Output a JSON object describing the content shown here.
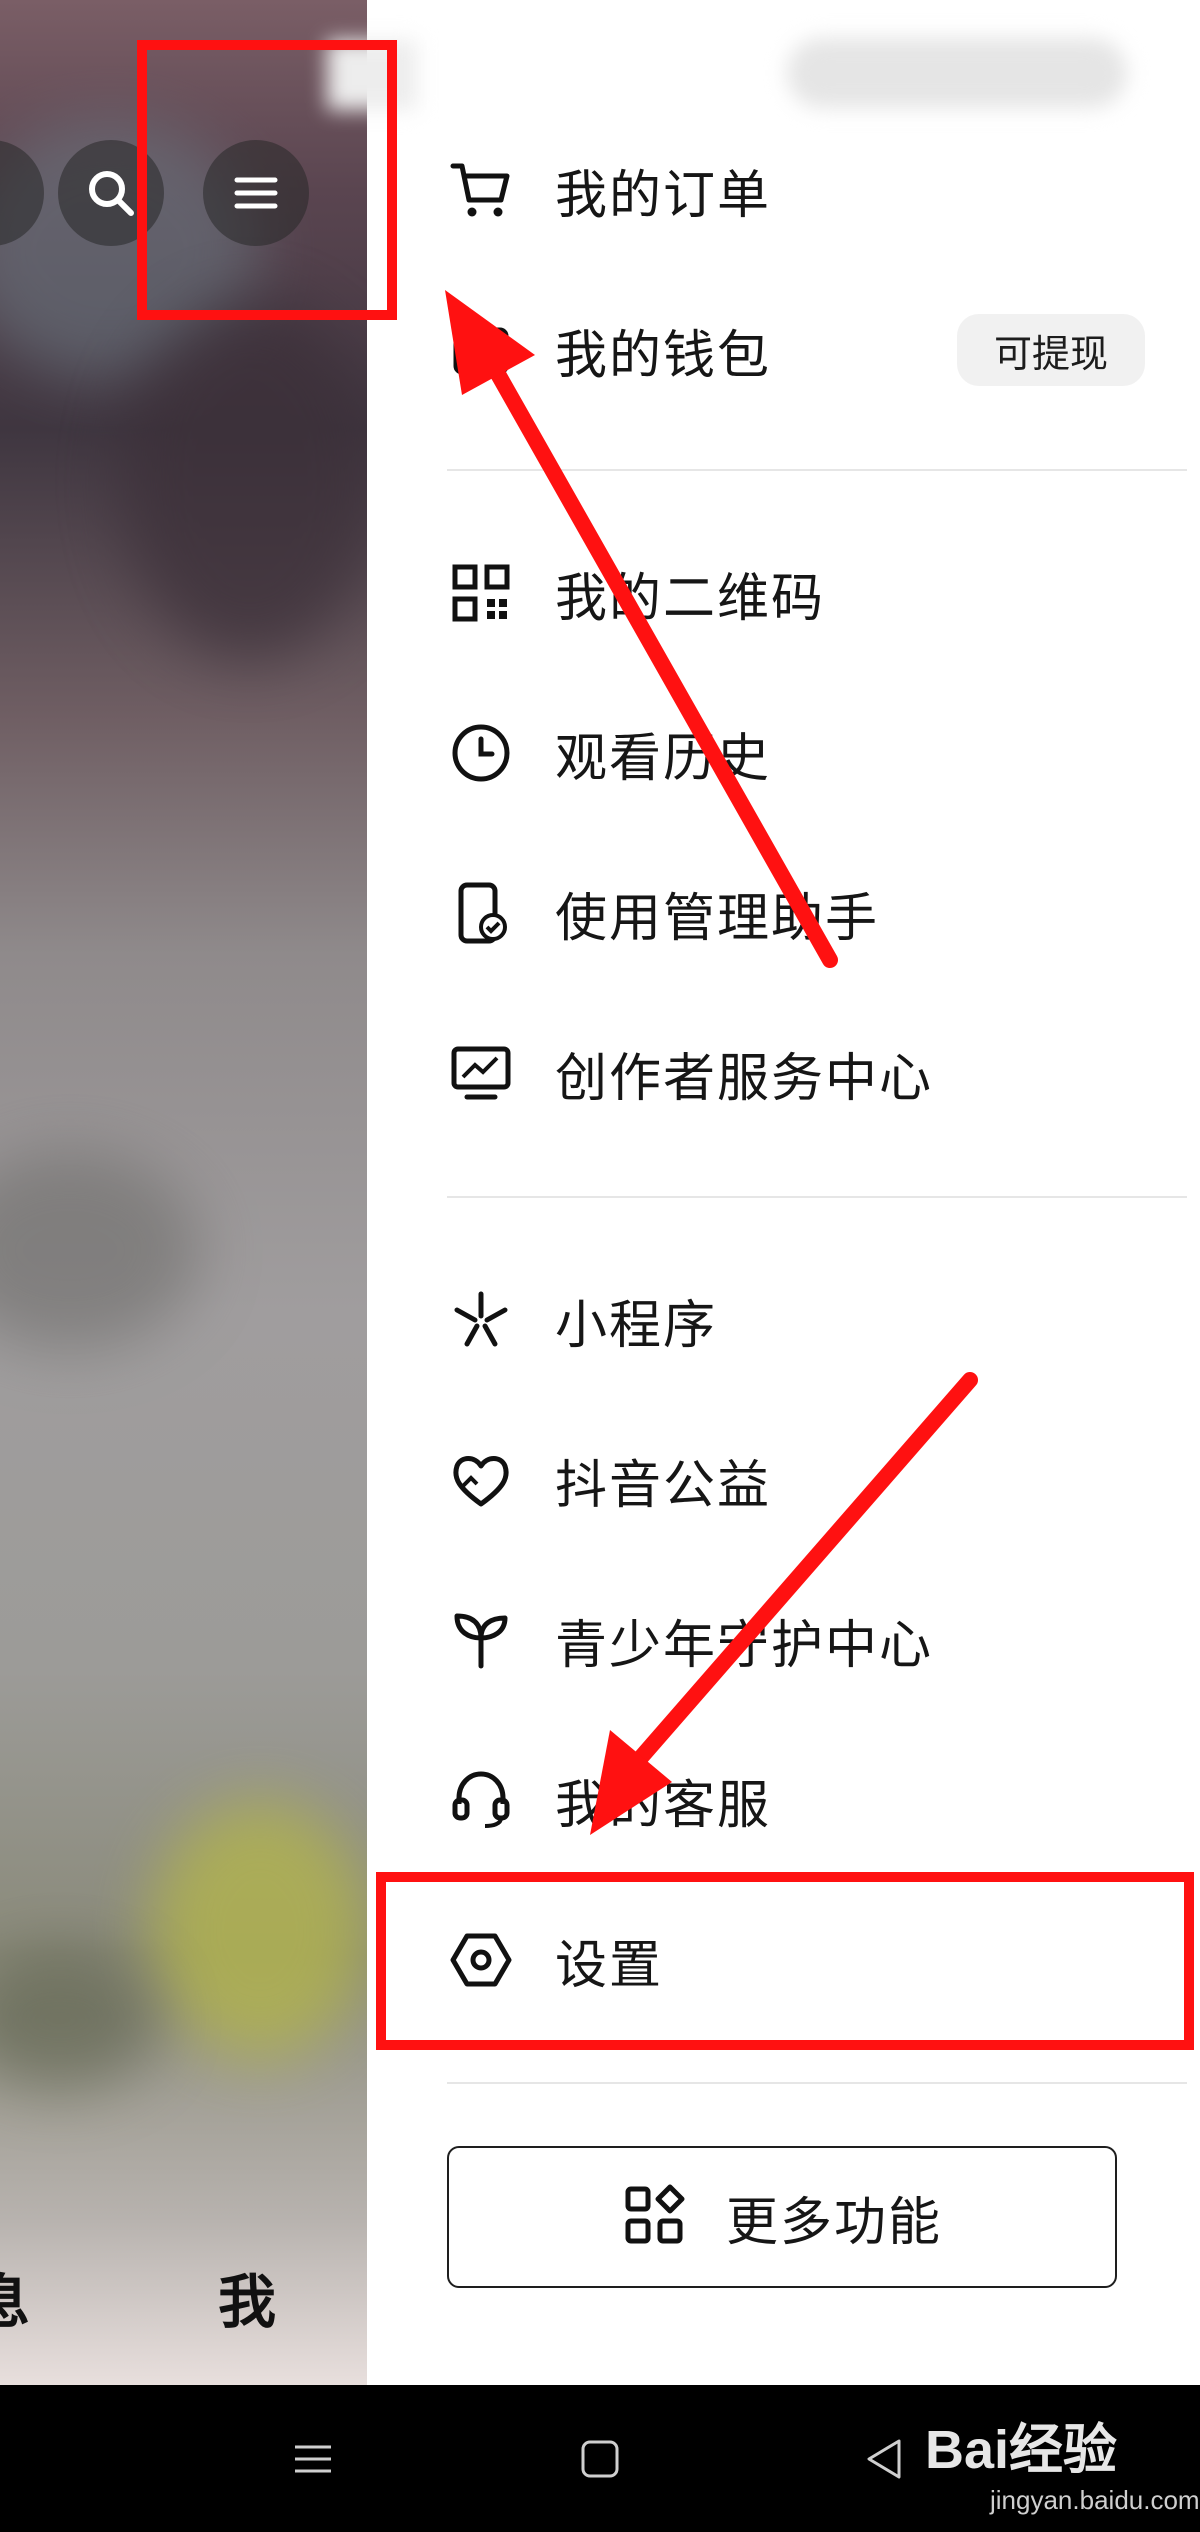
{
  "colors": {
    "annotation_red": "#ff1111",
    "drawer_bg": "#ffffff",
    "text_primary": "#161616",
    "pill_bg": "#f1f1f1",
    "nav_bar_bg": "#000000"
  },
  "background": {
    "top_icons": [
      "search-icon",
      "hamburger-menu-icon"
    ],
    "bottom_tabs": {
      "messages_partial": "息",
      "me": "我"
    }
  },
  "drawer": {
    "sections": [
      {
        "items": [
          {
            "label": "我的订单",
            "icon": "cart-icon"
          },
          {
            "label": "我的钱包",
            "icon": "wallet-icon",
            "badge": "可提现"
          }
        ]
      },
      {
        "items": [
          {
            "label": "我的二维码",
            "icon": "qr-code-icon"
          },
          {
            "label": "观看历史",
            "icon": "clock-icon"
          },
          {
            "label": "使用管理助手",
            "icon": "phone-check-icon"
          },
          {
            "label": "创作者服务中心",
            "icon": "monitor-chart-icon"
          }
        ]
      },
      {
        "items": [
          {
            "label": "小程序",
            "icon": "mini-program-icon"
          },
          {
            "label": "抖音公益",
            "icon": "heart-hands-icon"
          },
          {
            "label": "青少年守护中心",
            "icon": "sprout-icon"
          },
          {
            "label": "我的客服",
            "icon": "headset-icon"
          },
          {
            "label": "设置",
            "icon": "hexagon-gear-icon"
          }
        ]
      }
    ],
    "more_button": {
      "label": "更多功能",
      "icon": "grid-shapes-icon"
    }
  },
  "nav_bar": {
    "buttons": [
      "menu-icon",
      "home-square-icon",
      "back-triangle-icon"
    ],
    "watermark": "Bai经验",
    "watermark_sub": "jingyan.baidu.com"
  }
}
